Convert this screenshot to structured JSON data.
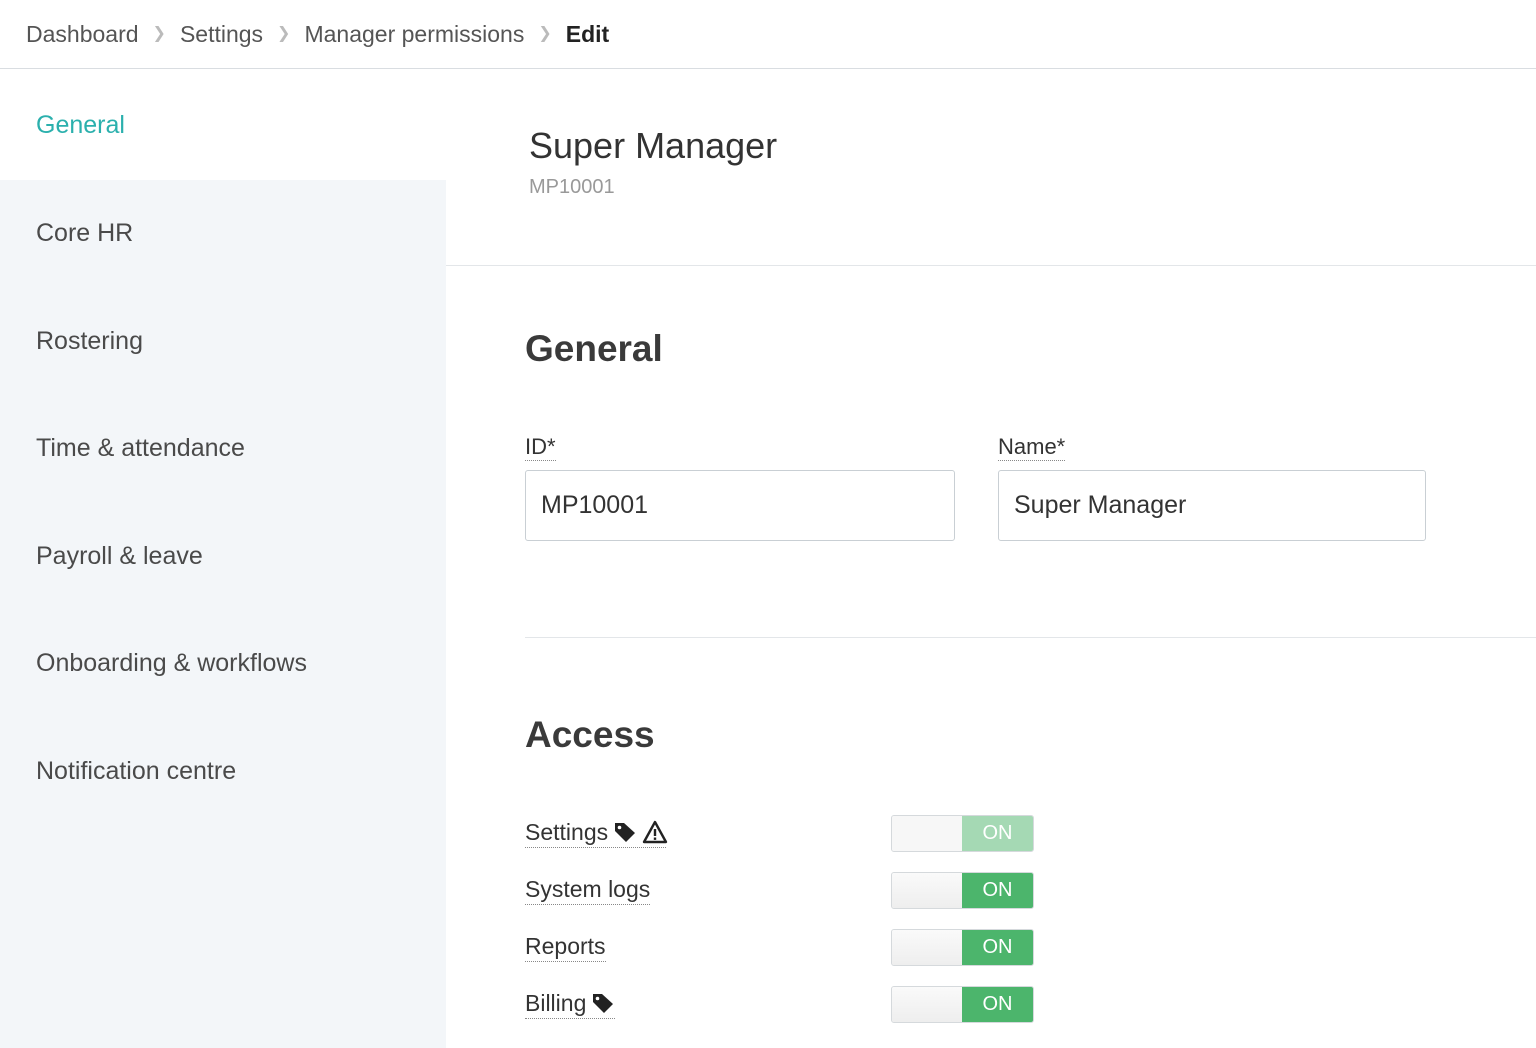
{
  "breadcrumb": {
    "items": [
      "Dashboard",
      "Settings",
      "Manager permissions"
    ],
    "current": "Edit"
  },
  "sidebar": {
    "items": [
      {
        "label": "General",
        "active": true
      },
      {
        "label": "Core HR"
      },
      {
        "label": "Rostering"
      },
      {
        "label": "Time & attendance"
      },
      {
        "label": "Payroll & leave"
      },
      {
        "label": "Onboarding & workflows"
      },
      {
        "label": "Notification centre"
      }
    ]
  },
  "record": {
    "title": "Super Manager",
    "code": "MP10001"
  },
  "general": {
    "title": "General",
    "id_label": "ID*",
    "id_value": "MP10001",
    "name_label": "Name*",
    "name_value": "Super Manager"
  },
  "access": {
    "title": "Access",
    "items": [
      {
        "label": "Settings",
        "icons": [
          "tag-icon",
          "warning-icon"
        ],
        "state": "ON",
        "disabled": true
      },
      {
        "label": "System logs",
        "icons": [],
        "state": "ON"
      },
      {
        "label": "Reports",
        "icons": [],
        "state": "ON"
      },
      {
        "label": "Billing",
        "icons": [
          "tag-icon"
        ],
        "state": "ON"
      }
    ]
  },
  "colors": {
    "accent": "#2bb0ad",
    "toggle_on": "#4cb56c",
    "toggle_on_disabled": "#a5d9b4",
    "sidebar_bg": "#f3f6f9"
  }
}
